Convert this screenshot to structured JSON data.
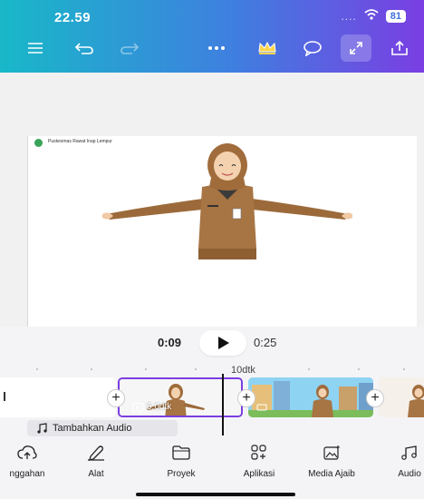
{
  "status_bar": {
    "time": "22.59",
    "dots": "....",
    "battery": "81"
  },
  "toolbar": {
    "icons": [
      "menu-icon",
      "undo-icon",
      "redo-icon",
      "more-icon",
      "crown-icon",
      "comment-icon",
      "expand-icon",
      "share-icon"
    ]
  },
  "canvas": {
    "caption": "Puskesmas Rawat Inap Lempur"
  },
  "playback": {
    "current_time": "0:09",
    "total_time": "0:25"
  },
  "timeline": {
    "ruler_label": "10dtk",
    "selected_clip_duration": "5.0dtk",
    "add_audio_label": "Tambahkan Audio"
  },
  "bottom_nav": {
    "items": [
      {
        "label": "nggahan",
        "icon": "upload-cloud-icon"
      },
      {
        "label": "Alat",
        "icon": "pen-icon"
      },
      {
        "label": "Proyek",
        "icon": "folder-icon"
      },
      {
        "label": "Aplikasi",
        "icon": "apps-icon"
      },
      {
        "label": "Media Ajaib",
        "icon": "magic-media-icon"
      },
      {
        "label": "Audio",
        "icon": "music-icon"
      }
    ]
  },
  "colors": {
    "accent": "#7b3ee0",
    "header_start": "#18b8c8",
    "header_end": "#7a3ee2"
  }
}
